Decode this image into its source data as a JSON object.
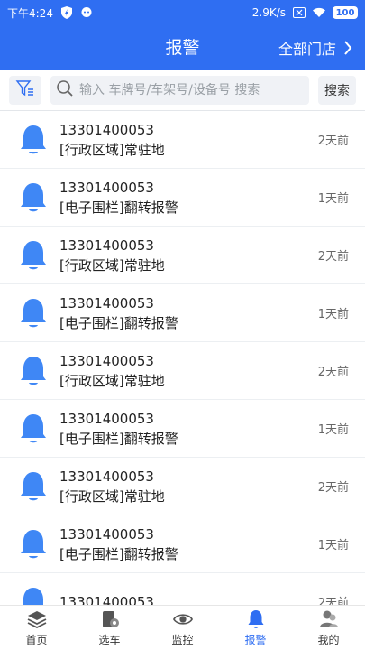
{
  "status_bar": {
    "time": "下午4:24",
    "net_speed": "2.9K/s",
    "battery": "100"
  },
  "header": {
    "title": "报警",
    "store_selector": "全部门店"
  },
  "search": {
    "placeholder": "输入 车牌号/车架号/设备号 搜索",
    "button_label": "搜索"
  },
  "alarms": [
    {
      "phone": "13301400053",
      "desc": "[行政区域]常驻地",
      "time": "2天前"
    },
    {
      "phone": "13301400053",
      "desc": "[电子围栏]翻转报警",
      "time": "1天前"
    },
    {
      "phone": "13301400053",
      "desc": "[行政区域]常驻地",
      "time": "2天前"
    },
    {
      "phone": "13301400053",
      "desc": "[电子围栏]翻转报警",
      "time": "1天前"
    },
    {
      "phone": "13301400053",
      "desc": "[行政区域]常驻地",
      "time": "2天前"
    },
    {
      "phone": "13301400053",
      "desc": "[电子围栏]翻转报警",
      "time": "1天前"
    },
    {
      "phone": "13301400053",
      "desc": "[行政区域]常驻地",
      "time": "2天前"
    },
    {
      "phone": "13301400053",
      "desc": "[电子围栏]翻转报警",
      "time": "1天前"
    },
    {
      "phone": "13301400053",
      "desc": "",
      "time": "2天前"
    }
  ],
  "tabs": [
    {
      "label": "首页",
      "icon": "layers-icon"
    },
    {
      "label": "选车",
      "icon": "car-doc-icon"
    },
    {
      "label": "监控",
      "icon": "eye-icon"
    },
    {
      "label": "报警",
      "icon": "bell-icon"
    },
    {
      "label": "我的",
      "icon": "user-icon"
    }
  ],
  "colors": {
    "primary": "#2f6ef2",
    "bell": "#3f87f5",
    "text": "#222222",
    "muted": "#666666"
  }
}
